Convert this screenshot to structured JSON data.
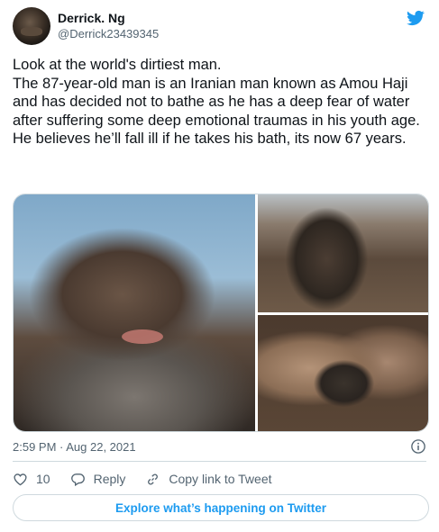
{
  "author": {
    "name": "Derrick. Ng",
    "handle": "@Derrick23439345"
  },
  "tweet": {
    "text": "Look at the world's dirtiest man.\nThe 87-year-old man is an Iranian man known as Amou Haji and has decided not to bathe as he has a deep fear of water after suffering some deep emotional traumas in his youth age.\nHe believes he’ll fall ill if he takes his bath, its now 67 years.",
    "timestamp": "2:59 PM · Aug 22, 2021"
  },
  "actions": {
    "like_count": "10",
    "reply_label": "Reply",
    "copy_label": "Copy link to Tweet"
  },
  "explore_label": "Explore what’s happening on Twitter",
  "colors": {
    "brand": "#1d9bf0",
    "text": "#0f1419",
    "muted": "#536471",
    "border": "#cfd9de"
  },
  "icons": [
    "twitter-bird-icon",
    "info-icon",
    "heart-icon",
    "reply-icon",
    "link-icon"
  ]
}
